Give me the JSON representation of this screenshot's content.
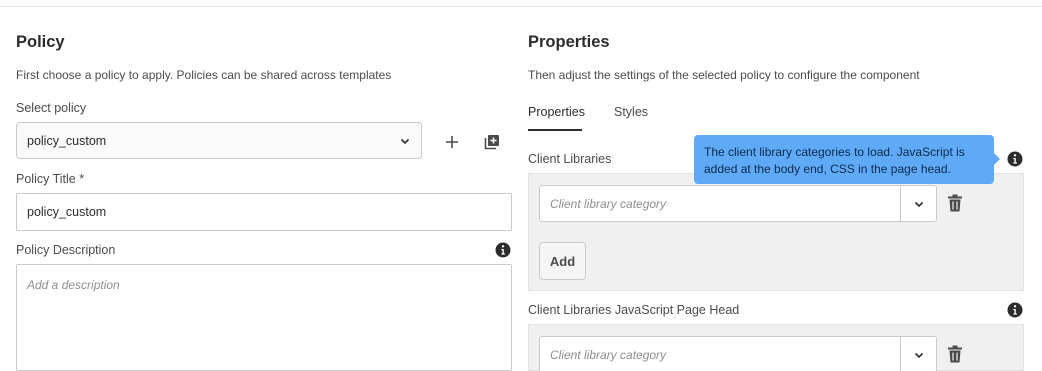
{
  "policy": {
    "title": "Policy",
    "description": "First choose a policy to apply. Policies can be shared across templates",
    "select_label": "Select policy",
    "selected_policy": "policy_custom",
    "title_label": "Policy Title *",
    "title_value": "policy_custom",
    "description_label": "Policy Description",
    "description_placeholder": "Add a description"
  },
  "properties": {
    "title": "Properties",
    "description": "Then adjust the settings of the selected policy to configure the component",
    "tabs": [
      {
        "label": "Properties",
        "active": true
      },
      {
        "label": "Styles",
        "active": false
      }
    ],
    "client_libraries": {
      "label": "Client Libraries",
      "placeholder": "Client library category",
      "add_label": "Add",
      "tooltip": "The client library categories to load. JavaScript is added at the body end, CSS in the page head."
    },
    "client_libraries_head": {
      "label": "Client Libraries JavaScript Page Head",
      "placeholder": "Client library category"
    }
  },
  "icons": [
    "chevron-down-icon",
    "plus-icon",
    "copy-policy-icon",
    "info-icon",
    "trash-icon"
  ]
}
